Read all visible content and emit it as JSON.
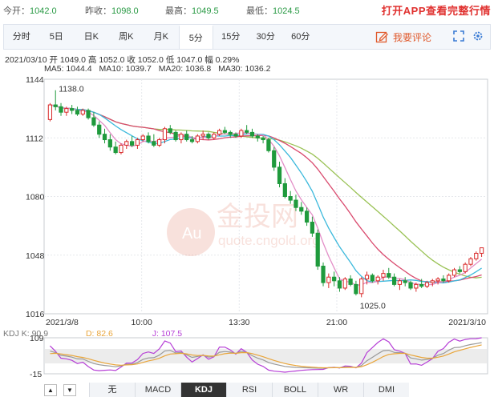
{
  "quote": {
    "open_label": "今开：",
    "open": "1042.0",
    "prev_close_label": "昨收：",
    "prev_close": "1098.0",
    "high_label": "最高：",
    "high": "1049.5",
    "low_label": "最低：",
    "low": "1024.5",
    "cta": "打开APP查看完整行情"
  },
  "tabs": [
    {
      "label": "分时"
    },
    {
      "label": "5日"
    },
    {
      "label": "日K"
    },
    {
      "label": "周K"
    },
    {
      "label": "月K"
    },
    {
      "label": "5分"
    },
    {
      "label": "15分"
    },
    {
      "label": "30分"
    },
    {
      "label": "60分"
    }
  ],
  "active_tab": "5分",
  "comment_label": "我要评论",
  "info": {
    "line": "2021/03/10  开 1049.0  高 1052.0  收 1052.0  低 1047.0  幅 0.29%",
    "ma5": "MA5: 1044.4",
    "ma10": "MA10: 1039.7",
    "ma20": "MA20: 1036.8",
    "ma30": "MA30: 1036.2"
  },
  "colors": {
    "ma5": "#e38ec7",
    "ma10": "#3cb9dc",
    "ma20": "#d94a6e",
    "ma30": "#9ac255",
    "up": "#d92a2a",
    "down": "#1f9a3c",
    "k": "#999999",
    "d": "#e9a53a",
    "j": "#b63fd6",
    "quote_value": "#2a9a45",
    "cta": "#e0312f"
  },
  "watermark": {
    "brand": "金投网",
    "url": "quote.cngold.org",
    "badge": "Au"
  },
  "chart_data": {
    "type": "candlestick",
    "y_ticks": [
      "1144",
      "1112",
      "1080",
      "1048",
      "1016"
    ],
    "y_range": [
      1016,
      1144
    ],
    "x_labels": [
      "2021/3/8",
      "10:00",
      "13:30",
      "21:00",
      "2021/3/10"
    ],
    "annotations": {
      "high_label": "1138.0",
      "low_label": "1025.0"
    },
    "ohlc": [
      [
        1122,
        1131,
        1121,
        1130
      ],
      [
        1130,
        1138,
        1127,
        1129
      ],
      [
        1129,
        1131,
        1124,
        1126
      ],
      [
        1126,
        1129,
        1124,
        1128
      ],
      [
        1128,
        1130,
        1125,
        1127
      ],
      [
        1127,
        1129,
        1124,
        1125
      ],
      [
        1125,
        1128,
        1124,
        1127
      ],
      [
        1127,
        1128,
        1122,
        1123
      ],
      [
        1123,
        1126,
        1118,
        1119
      ],
      [
        1119,
        1121,
        1112,
        1114
      ],
      [
        1114,
        1117,
        1109,
        1111
      ],
      [
        1111,
        1114,
        1105,
        1107
      ],
      [
        1107,
        1110,
        1103,
        1104
      ],
      [
        1104,
        1109,
        1103,
        1108
      ],
      [
        1108,
        1111,
        1106,
        1110
      ],
      [
        1110,
        1113,
        1107,
        1108
      ],
      [
        1108,
        1112,
        1106,
        1111
      ],
      [
        1111,
        1114,
        1110,
        1113
      ],
      [
        1113,
        1115,
        1109,
        1110
      ],
      [
        1110,
        1114,
        1107,
        1108
      ],
      [
        1108,
        1112,
        1107,
        1111
      ],
      [
        1111,
        1118,
        1109,
        1117
      ],
      [
        1117,
        1119,
        1114,
        1115
      ],
      [
        1115,
        1116,
        1110,
        1111
      ],
      [
        1111,
        1115,
        1109,
        1114
      ],
      [
        1114,
        1116,
        1110,
        1111
      ],
      [
        1111,
        1113,
        1109,
        1110
      ],
      [
        1110,
        1114,
        1109,
        1113
      ],
      [
        1113,
        1116,
        1111,
        1114
      ],
      [
        1114,
        1115,
        1111,
        1112
      ],
      [
        1112,
        1115,
        1111,
        1114
      ],
      [
        1114,
        1117,
        1113,
        1116
      ],
      [
        1116,
        1118,
        1114,
        1115
      ],
      [
        1115,
        1116,
        1112,
        1114
      ],
      [
        1114,
        1115,
        1112,
        1113
      ],
      [
        1113,
        1117,
        1112,
        1116
      ],
      [
        1116,
        1119,
        1114,
        1115
      ],
      [
        1115,
        1117,
        1112,
        1113
      ],
      [
        1113,
        1114,
        1110,
        1112
      ],
      [
        1112,
        1113,
        1109,
        1111
      ],
      [
        1111,
        1112,
        1104,
        1105
      ],
      [
        1105,
        1107,
        1094,
        1096
      ],
      [
        1096,
        1099,
        1085,
        1087
      ],
      [
        1087,
        1090,
        1079,
        1080
      ],
      [
        1080,
        1083,
        1076,
        1078
      ],
      [
        1078,
        1081,
        1072,
        1074
      ],
      [
        1074,
        1077,
        1070,
        1072
      ],
      [
        1072,
        1074,
        1064,
        1066
      ],
      [
        1066,
        1069,
        1058,
        1060
      ],
      [
        1060,
        1062,
        1040,
        1042
      ],
      [
        1042,
        1044,
        1031,
        1033
      ],
      [
        1033,
        1038,
        1030,
        1036
      ],
      [
        1036,
        1039,
        1031,
        1034
      ],
      [
        1034,
        1036,
        1028,
        1030
      ],
      [
        1030,
        1036,
        1029,
        1035
      ],
      [
        1035,
        1037,
        1031,
        1032
      ],
      [
        1032,
        1034,
        1026,
        1027
      ],
      [
        1027,
        1036,
        1025,
        1035
      ],
      [
        1035,
        1039,
        1032,
        1037
      ],
      [
        1037,
        1038,
        1033,
        1034
      ],
      [
        1034,
        1037,
        1032,
        1036
      ],
      [
        1036,
        1040,
        1034,
        1038
      ],
      [
        1038,
        1041,
        1035,
        1036
      ],
      [
        1036,
        1038,
        1031,
        1032
      ],
      [
        1032,
        1035,
        1029,
        1034
      ],
      [
        1034,
        1036,
        1031,
        1033
      ],
      [
        1033,
        1034,
        1029,
        1030
      ],
      [
        1030,
        1033,
        1028,
        1032
      ],
      [
        1032,
        1035,
        1030,
        1031
      ],
      [
        1031,
        1034,
        1030,
        1033
      ],
      [
        1033,
        1035,
        1031,
        1034
      ],
      [
        1034,
        1036,
        1032,
        1035
      ],
      [
        1035,
        1037,
        1033,
        1034
      ],
      [
        1034,
        1038,
        1033,
        1037
      ],
      [
        1037,
        1041,
        1036,
        1040
      ],
      [
        1040,
        1042,
        1038,
        1039
      ],
      [
        1039,
        1044,
        1038,
        1043
      ],
      [
        1043,
        1047,
        1042,
        1046
      ],
      [
        1046,
        1050,
        1045,
        1049
      ],
      [
        1049,
        1052,
        1047,
        1052
      ]
    ],
    "kdj": {
      "k_label": "KDJ  K: 90.9",
      "d_label": "D: 82.6",
      "j_label": "J: 107.5",
      "y_ticks": [
        "109",
        "-15"
      ],
      "y_range": [
        -15,
        109
      ]
    }
  },
  "indicator_tabs": [
    {
      "label": "无"
    },
    {
      "label": "MACD"
    },
    {
      "label": "KDJ"
    },
    {
      "label": "RSI"
    },
    {
      "label": "BOLL"
    },
    {
      "label": "WR"
    },
    {
      "label": "DMI"
    }
  ],
  "active_indicator": "KDJ",
  "nav": {
    "up": "▲",
    "down": "▼"
  }
}
